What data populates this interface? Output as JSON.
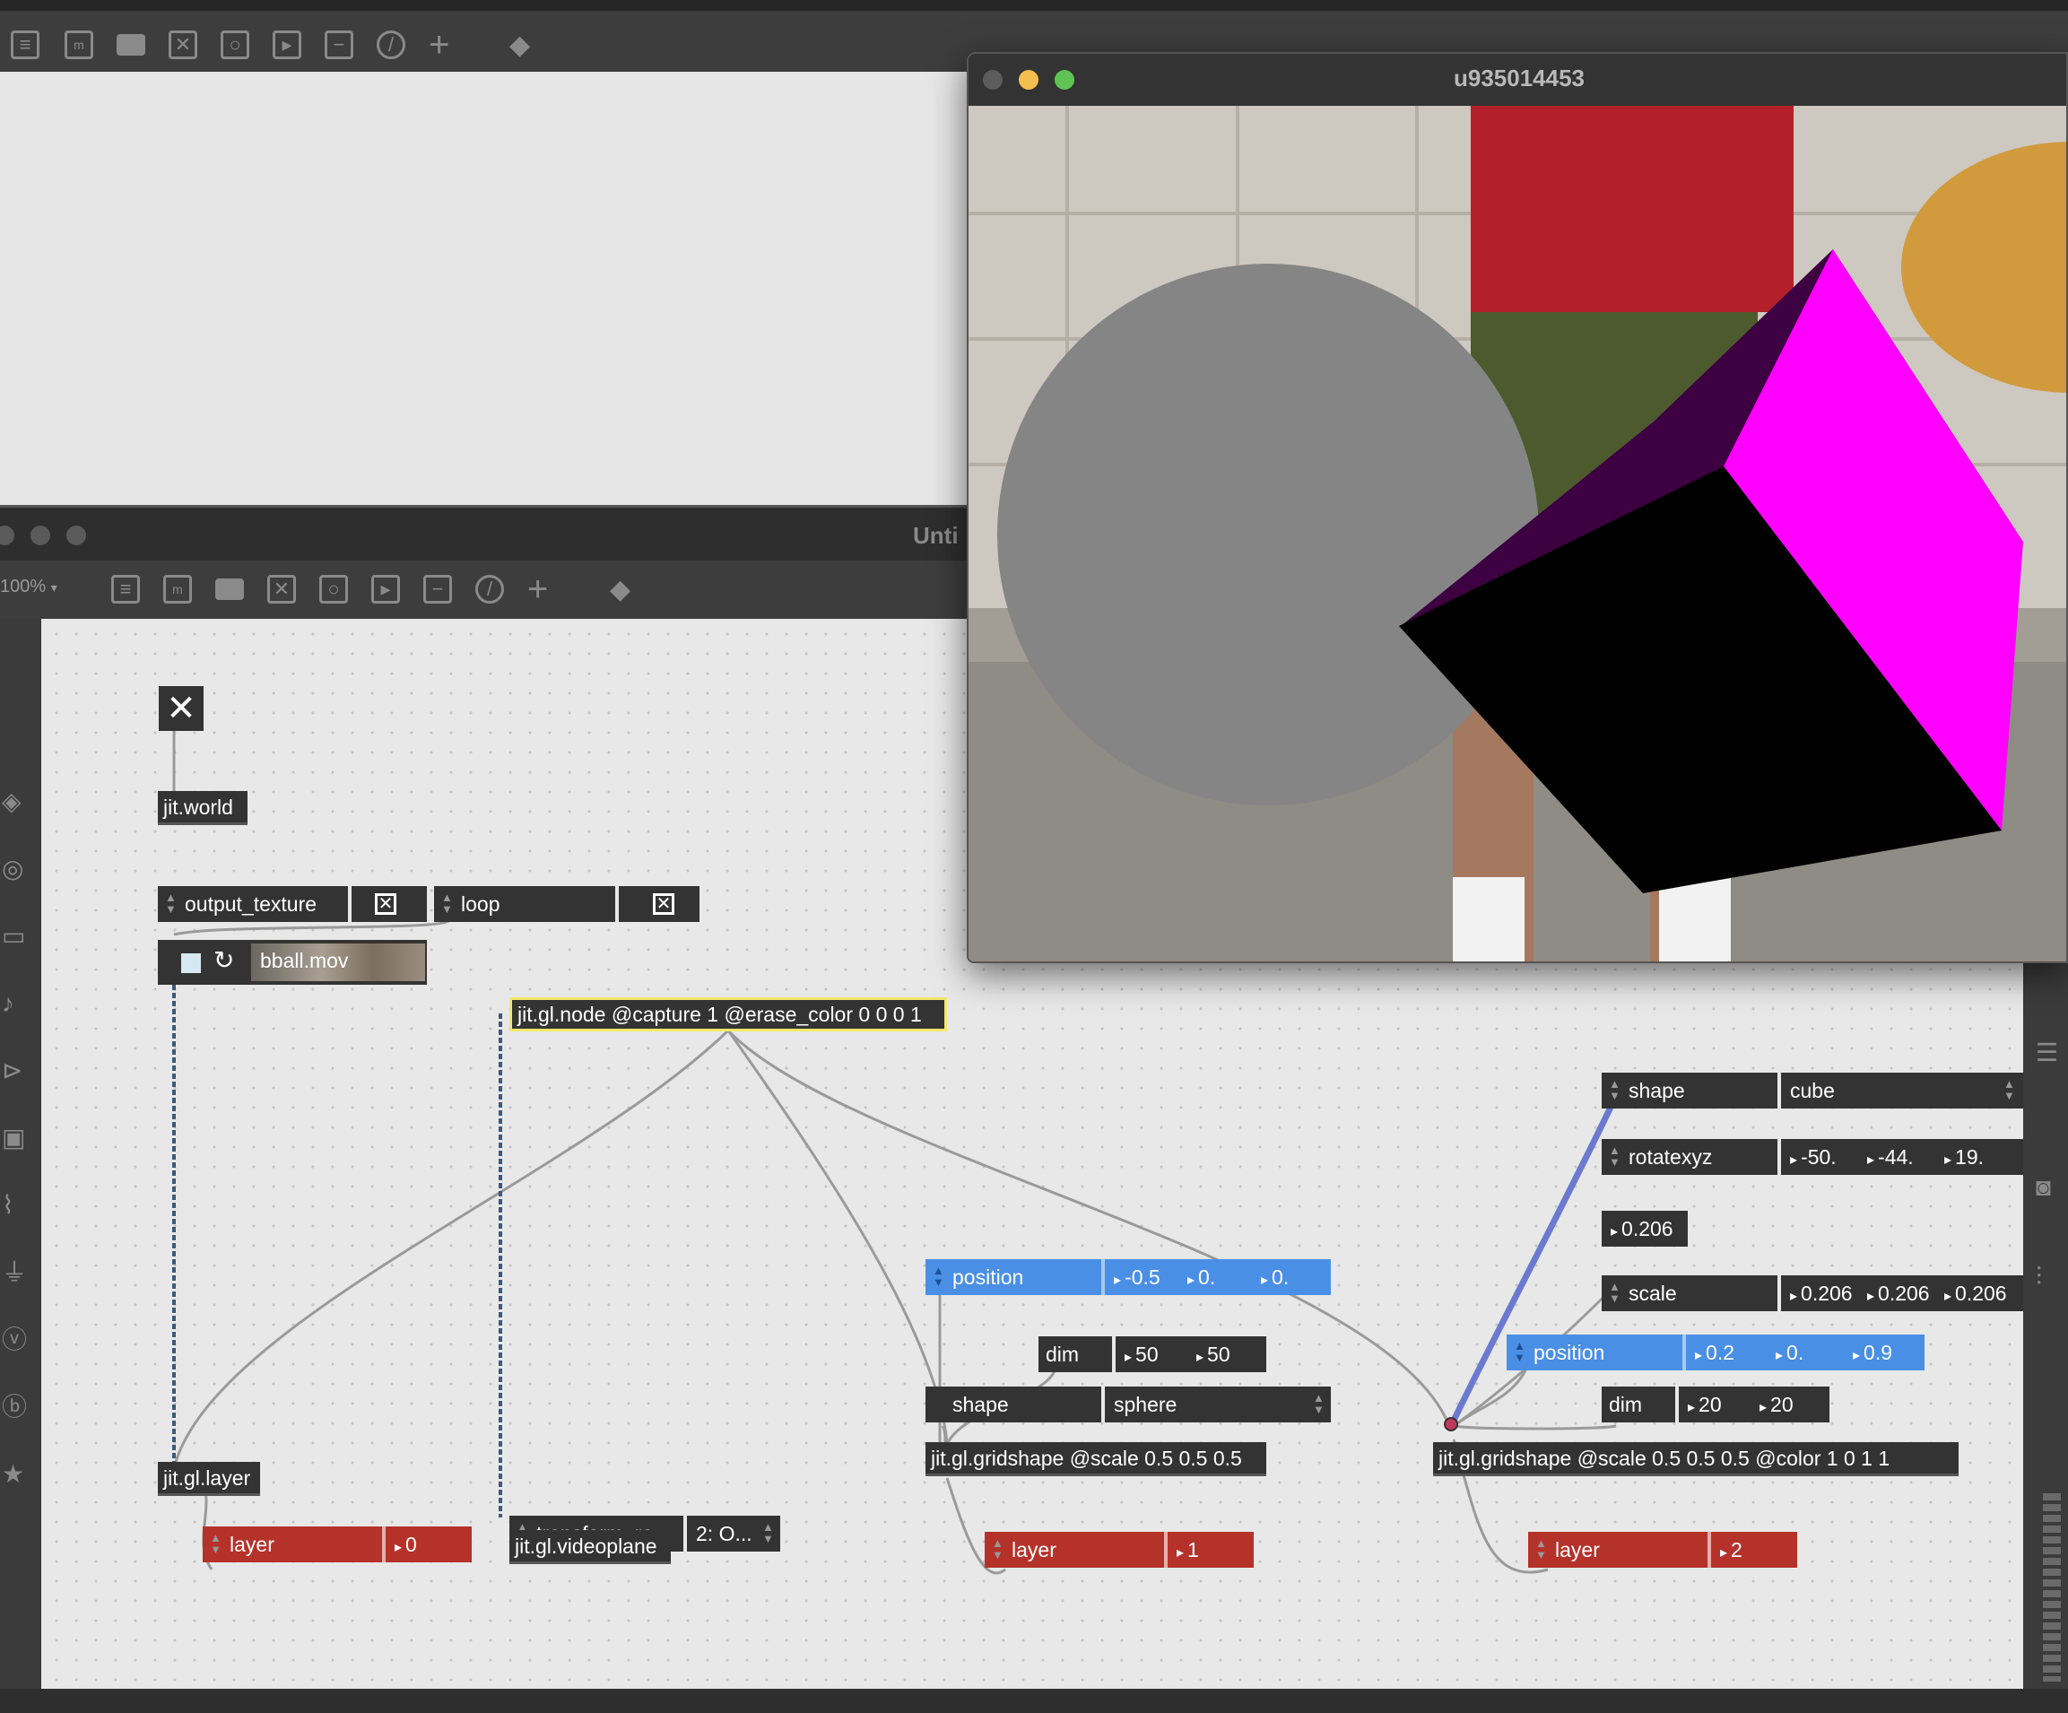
{
  "back_window": {
    "toolbar_icons": [
      "patcher-icon",
      "message-icon",
      "comment-icon",
      "toggle-icon",
      "button-icon",
      "number-icon",
      "slider-icon",
      "dial-icon",
      "add-icon",
      "paint-icon"
    ]
  },
  "main_window": {
    "title": "Unti",
    "zoom": "100%",
    "zoom_arrow": "▾"
  },
  "render_window": {
    "title": "u935014453",
    "traffic_light_colors": [
      "#5c5c5c",
      "#f5bf4f",
      "#5fc454"
    ],
    "scene": {
      "sphere_color": "#858585",
      "cube_front_color": "#000000",
      "cube_side_color": "#ff00ff",
      "cube_top_color": "#3d0040"
    }
  },
  "patch": {
    "toggle_world": "✕",
    "jit_world": "jit.world",
    "output_texture": {
      "name": "output_texture",
      "check": "✕"
    },
    "loop": {
      "name": "loop",
      "check": "✕"
    },
    "movie": {
      "file": "bball.mov"
    },
    "node": "jit.gl.node @capture 1 @erase_color 0 0 0 1",
    "jit_layer": "jit.gl.layer",
    "layer0": {
      "name": "layer",
      "value": "0"
    },
    "transform": {
      "name": "transform_re...",
      "value": "2: O..."
    },
    "videoplane": "jit.gl.videoplane",
    "sphere_group": {
      "position": {
        "name": "position",
        "values": [
          "-0.5",
          "0.",
          "0."
        ]
      },
      "dim": {
        "name": "dim",
        "values": [
          "50",
          "50"
        ]
      },
      "shape": {
        "name": "shape",
        "value": "sphere"
      },
      "gridshape": "jit.gl.gridshape @scale 0.5 0.5 0.5",
      "layer": {
        "name": "layer",
        "value": "1"
      }
    },
    "cube_group": {
      "shape": {
        "name": "shape",
        "value": "cube"
      },
      "rotatexyz": {
        "name": "rotatexyz",
        "values": [
          "-50.",
          "-44.",
          "19."
        ]
      },
      "flonum": "0.206",
      "scale": {
        "name": "scale",
        "values": [
          "0.206",
          "0.206",
          "0.206"
        ]
      },
      "position": {
        "name": "position",
        "values": [
          "0.2",
          "0.",
          "0.9"
        ]
      },
      "dim": {
        "name": "dim",
        "values": [
          "20",
          "20"
        ]
      },
      "gridshape": "jit.gl.gridshape @scale 0.5 0.5 0.5 @color 1 0 1 1",
      "layer": {
        "name": "layer",
        "value": "2"
      }
    }
  },
  "colors": {
    "object_bg": "#333333",
    "attr_blue": "#4a8fe6",
    "attr_red": "#b5322a",
    "selection": "#f3e86b",
    "patch_cord": "#9a9a9a",
    "matrix_cord": "#3b5a7a"
  }
}
